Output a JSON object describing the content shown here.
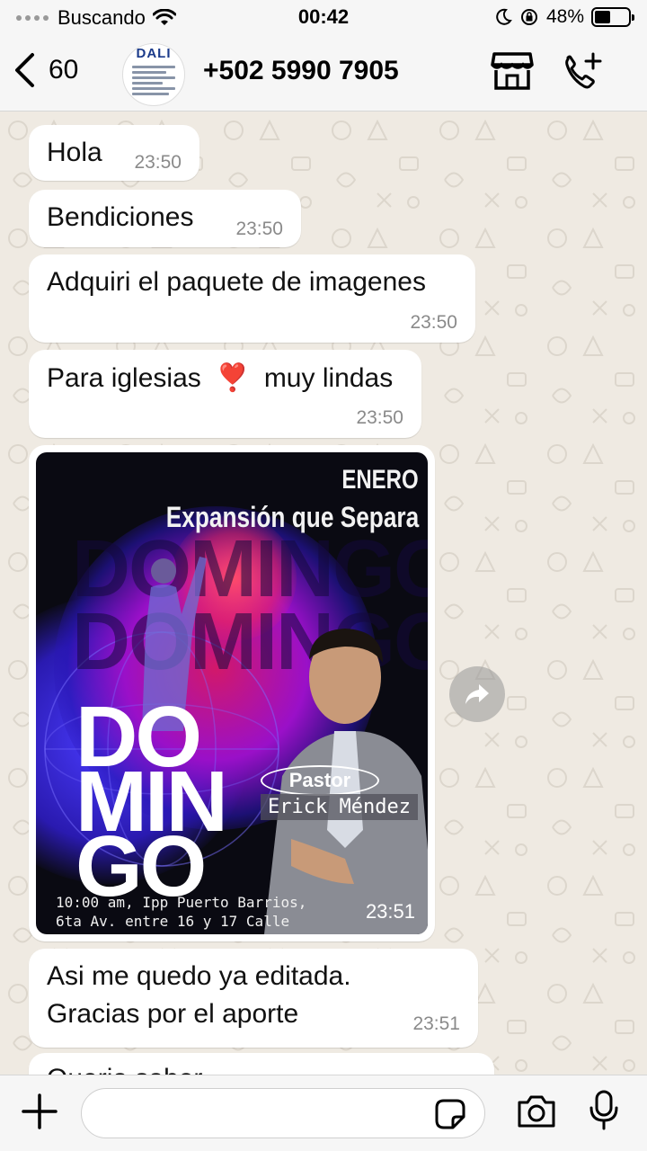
{
  "status": {
    "carrier": "Buscando",
    "time": "00:42",
    "battery": "48%",
    "battery_level": 0.48
  },
  "header": {
    "back_count": "60",
    "avatar_text": "DALI",
    "contact": "+502 5990 7905",
    "store_icon": "store-icon",
    "add_call_icon": "phone-plus-icon"
  },
  "messages": [
    {
      "text": "Hola",
      "time": "23:50"
    },
    {
      "text": "Bendiciones",
      "time": "23:50"
    },
    {
      "text": "Adquiri el paquete de imagenes",
      "time": "23:50"
    },
    {
      "text": "Para iglesias",
      "emoji": "❣️",
      "text2": "muy lindas",
      "time": "23:50"
    },
    {
      "line1": "Asi me quedo ya editada.",
      "line2": "Gracias por el aporte",
      "time": "23:51"
    },
    {
      "text": "Queria saber",
      "partial": true
    }
  ],
  "image_message": {
    "time": "23:51",
    "poster": {
      "month": "ENERO",
      "title": "Expansión que Separa",
      "big_1": "DO",
      "big_2": "MIN",
      "big_3": "GO",
      "pastor_label": "Pastor",
      "pastor_name": "Erick Méndez",
      "info_1": "10:00 am, Ipp Puerto Barrios,",
      "info_2": "6ta Av. entre 16 y 17 Calle"
    }
  },
  "input": {
    "placeholder": ""
  },
  "colors": {
    "chat_bg": "#efeae2",
    "bubble": "#ffffff",
    "bar": "#f6f6f6"
  }
}
